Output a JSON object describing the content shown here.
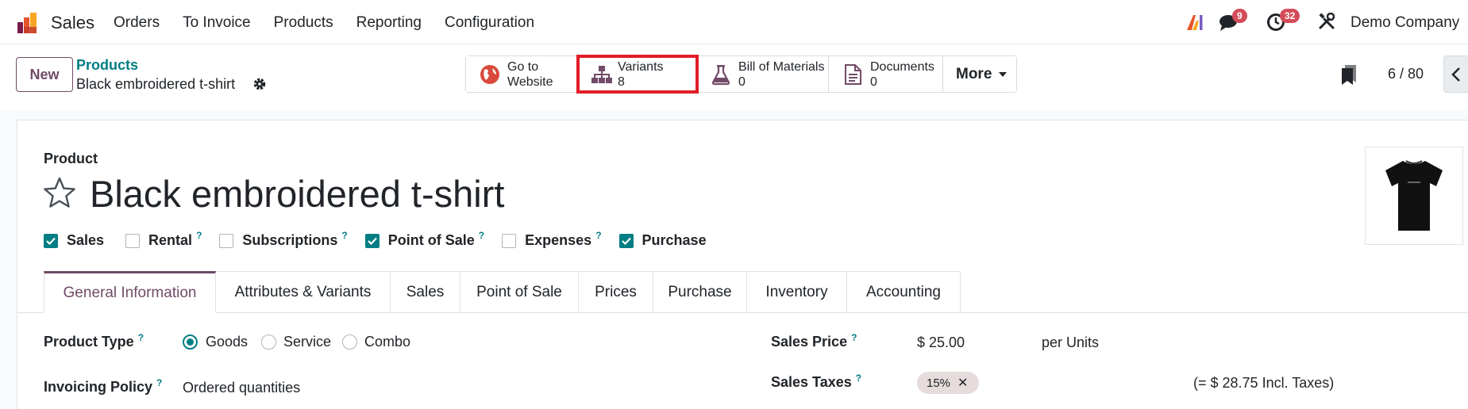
{
  "topnav": {
    "app_name": "Sales",
    "menu": [
      "Orders",
      "To Invoice",
      "Products",
      "Reporting",
      "Configuration"
    ],
    "chat_count": "9",
    "activity_count": "32",
    "company": "Demo Company",
    "icons": [
      "app-logo-icon",
      "ai-icon",
      "chat-icon",
      "clock-icon",
      "tools-icon"
    ]
  },
  "control": {
    "new_label": "New",
    "breadcrumb_parent": "Products",
    "breadcrumb_current": "Black embroidered t-shirt",
    "pager": "6 / 80"
  },
  "smart_buttons": {
    "website_line1": "Go to",
    "website_line2": "Website",
    "variants_label": "Variants",
    "variants_count": "8",
    "bom_label": "Bill of Materials",
    "bom_count": "0",
    "documents_label": "Documents",
    "documents_count": "0",
    "more_label": "More"
  },
  "product": {
    "field_label": "Product",
    "name": "Black embroidered t-shirt",
    "options": [
      {
        "label": "Sales",
        "checked": true,
        "help": ""
      },
      {
        "label": "Rental",
        "checked": false,
        "help": "?"
      },
      {
        "label": "Subscriptions",
        "checked": false,
        "help": "?"
      },
      {
        "label": "Point of Sale",
        "checked": true,
        "help": "?"
      },
      {
        "label": "Expenses",
        "checked": false,
        "help": "?"
      },
      {
        "label": "Purchase",
        "checked": true,
        "help": ""
      }
    ]
  },
  "tabs": [
    "General Information",
    "Attributes & Variants",
    "Sales",
    "Point of Sale",
    "Prices",
    "Purchase",
    "Inventory",
    "Accounting"
  ],
  "form": {
    "product_type_label": "Product Type",
    "product_type_options": [
      "Goods",
      "Service",
      "Combo"
    ],
    "product_type_selected": "Goods",
    "invoicing_policy_label": "Invoicing Policy",
    "invoicing_policy_value": "Ordered quantities",
    "sales_price_label": "Sales Price",
    "sales_price_value": "$ 25.00",
    "sales_price_unit": "per Units",
    "sales_taxes_label": "Sales Taxes",
    "sales_tax_tag": "15%",
    "incl_taxes": "(= $ 28.75 Incl. Taxes)",
    "help": "?"
  },
  "colors": {
    "brand": "#714b67",
    "accent": "#017e84",
    "badge": "#d44c59",
    "highlight": "#e21d26"
  }
}
